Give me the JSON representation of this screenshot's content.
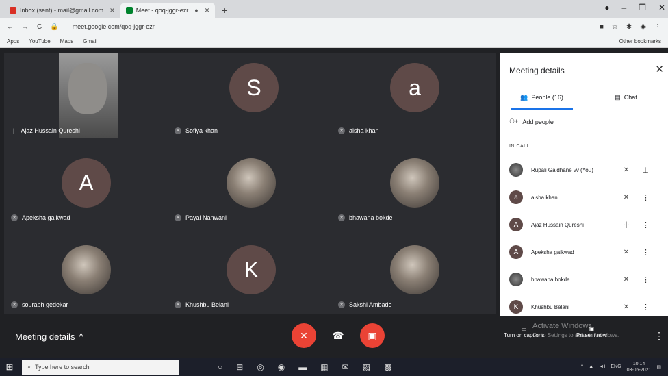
{
  "browser": {
    "tabs": [
      {
        "title": "Inbox (sent) - mail@gmail.com",
        "active": false,
        "favicon_color": "#d93025"
      },
      {
        "title": "Meet - qoq-jggr-ezr",
        "active": true,
        "favicon_color": "#00832d"
      }
    ],
    "url": "meet.google.com/qoq-jggr-ezr",
    "bookmarks": [
      "Apps",
      "YouTube",
      "Maps",
      "Gmail"
    ],
    "other_bookmarks": "Other bookmarks"
  },
  "participants_grid": [
    {
      "name": "Ajaz Hussain Qureshi",
      "type": "video"
    },
    {
      "name": "Sofiya khan",
      "type": "letter",
      "letter": "S"
    },
    {
      "name": "aisha khan",
      "type": "letter",
      "letter": "a"
    },
    {
      "name": "Apeksha gaikwad",
      "type": "letter",
      "letter": "A"
    },
    {
      "name": "Payal Nanwani",
      "type": "photo"
    },
    {
      "name": "bhawana bokde",
      "type": "photo"
    },
    {
      "name": "sourabh gedekar",
      "type": "photo"
    },
    {
      "name": "Khushbu Belani",
      "type": "letter",
      "letter": "K"
    },
    {
      "name": "Sakshi Ambade",
      "type": "photo"
    }
  ],
  "panel": {
    "title": "Meeting details",
    "tab_people": "People (16)",
    "tab_chat": "Chat",
    "add_people": "Add people",
    "in_call_label": "IN CALL",
    "people": [
      {
        "name": "Rupali Gaidhane vv (You)",
        "avatar": "photo",
        "status": "mic-off",
        "action": "pin"
      },
      {
        "name": "aisha khan",
        "avatar": "a",
        "status": "mic-off",
        "action": "more"
      },
      {
        "name": "Ajaz Hussain Qureshi",
        "avatar": "A",
        "status": "speaking",
        "action": "more"
      },
      {
        "name": "Apeksha gaikwad",
        "avatar": "A",
        "status": "mic-off",
        "action": "more"
      },
      {
        "name": "bhawana bokde",
        "avatar": "photo",
        "status": "mic-off",
        "action": "more"
      },
      {
        "name": "Khushbu Belani",
        "avatar": "K",
        "status": "mic-off",
        "action": "more"
      }
    ]
  },
  "bottom": {
    "meeting_details": "Meeting details",
    "turn_on_captions": "Turn on captions",
    "present_now": "Present now",
    "watermark_title": "Activate Windows",
    "watermark_sub": "Go to Settings to activate Windows."
  },
  "taskbar": {
    "search_placeholder": "Type here to search",
    "lang": "ENG",
    "time": "10:14",
    "date": "03-05-2021"
  },
  "colors": {
    "danger": "#ea4335",
    "accent": "#1a73e8",
    "tile_bg": "#2b2c30",
    "avatar_bg": "#5f4a48"
  }
}
